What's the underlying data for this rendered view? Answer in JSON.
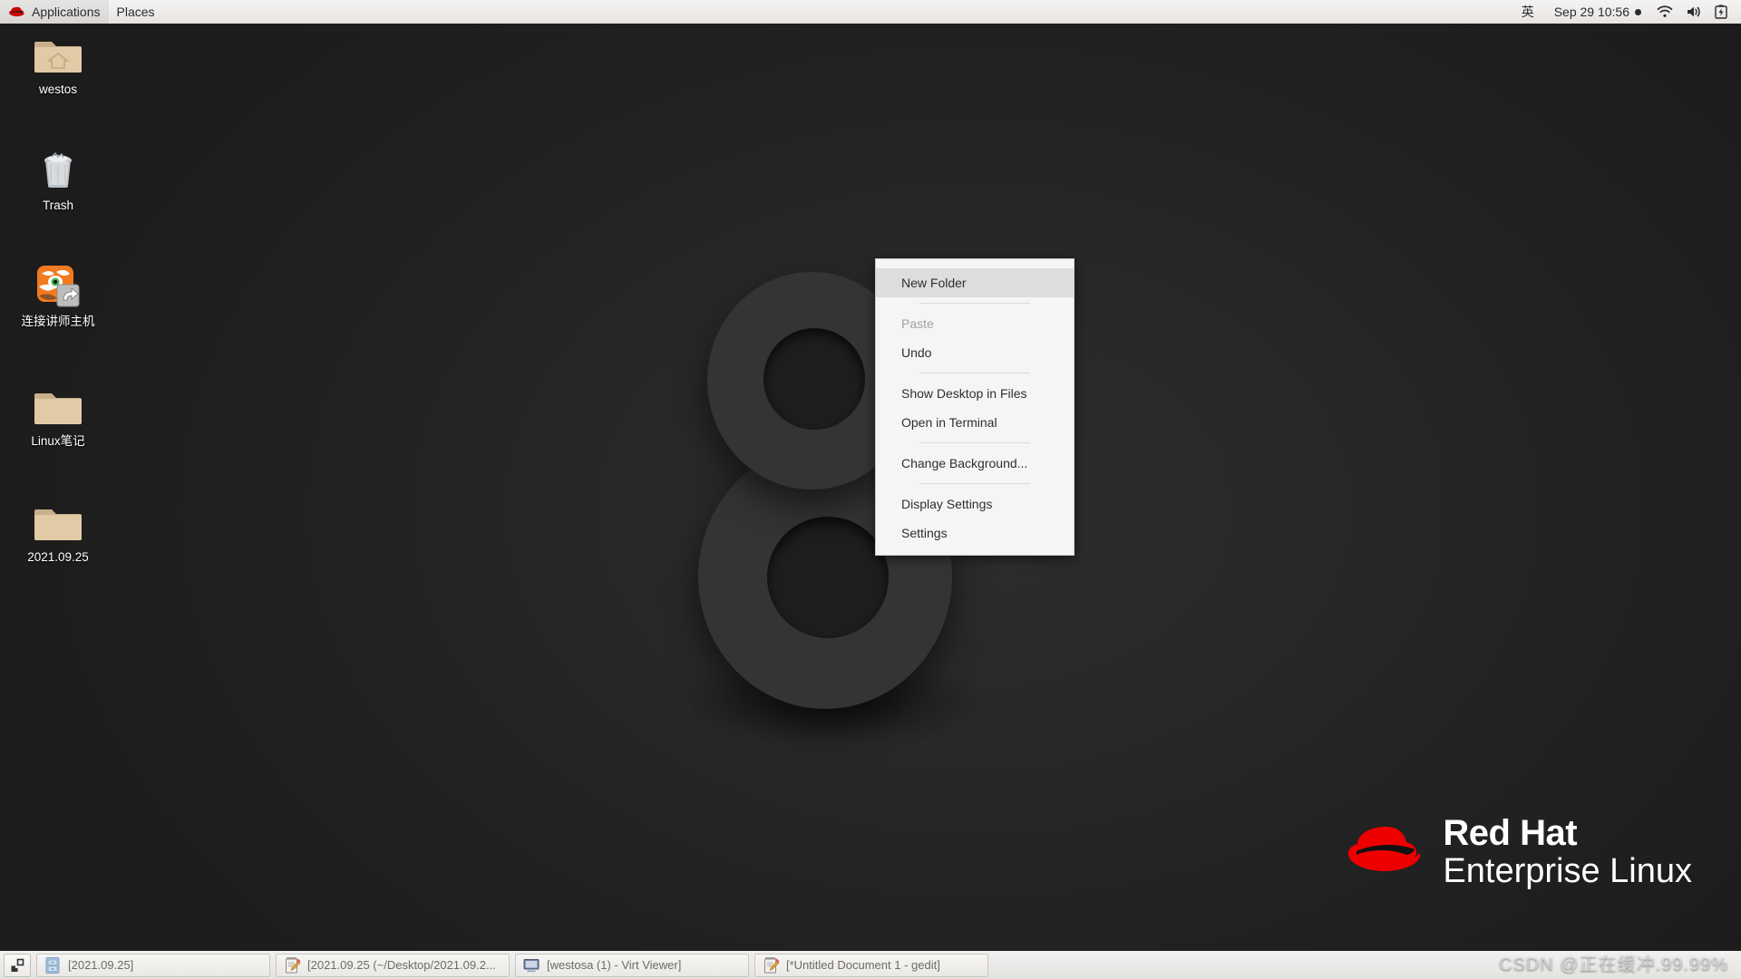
{
  "top_panel": {
    "logo_icon": "redhat-hat-icon",
    "menus": [
      {
        "label": "Applications"
      },
      {
        "label": "Places"
      }
    ],
    "input_method": "英",
    "clock": "Sep 29  10:56",
    "clock_indicator": "notification-dot",
    "tray": [
      {
        "icon": "wifi-icon"
      },
      {
        "icon": "volume-icon"
      },
      {
        "icon": "battery-charging-icon"
      }
    ]
  },
  "desktop_icons": [
    {
      "label": "westos",
      "icon": "home-folder-icon"
    },
    {
      "label": "Trash",
      "icon": "trash-icon"
    },
    {
      "label": "连接讲师主机",
      "icon": "shortcut-launcher-icon"
    },
    {
      "label": "Linux笔记",
      "icon": "folder-icon"
    },
    {
      "label": "2021.09.25",
      "icon": "folder-icon"
    }
  ],
  "context_menu": {
    "items": [
      {
        "label": "New Folder",
        "state": "highlighted"
      },
      {
        "label": "Paste",
        "state": "disabled"
      },
      {
        "label": "Undo",
        "state": "normal"
      },
      {
        "label": "Show Desktop in Files",
        "state": "normal"
      },
      {
        "label": "Open in Terminal",
        "state": "normal"
      },
      {
        "label": "Change Background...",
        "state": "normal"
      },
      {
        "label": "Display Settings",
        "state": "normal"
      },
      {
        "label": "Settings",
        "state": "normal"
      }
    ]
  },
  "branding": {
    "line1": "Red Hat",
    "line2": "Enterprise Linux",
    "logo_icon": "redhat-hat-icon",
    "accent_color": "#ee0000"
  },
  "taskbar": {
    "show_desktop_icon": "show-desktop-icon",
    "windows": [
      {
        "label": "[2021.09.25]",
        "icon": "file-manager-icon"
      },
      {
        "label": "[2021.09.25 (~/Desktop/2021.09.2...",
        "icon": "gedit-icon"
      },
      {
        "label": "[westosa (1) - Virt Viewer]",
        "icon": "virt-viewer-icon"
      },
      {
        "label": "[*Untitled Document 1 - gedit]",
        "icon": "gedit-icon"
      }
    ]
  },
  "watermark": {
    "text": "CSDN @正在缓冲.99.99%"
  }
}
